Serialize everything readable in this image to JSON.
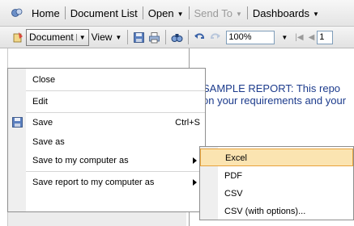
{
  "topnav": {
    "home": "Home",
    "document_list": "Document List",
    "open": "Open",
    "send_to": "Send To",
    "dashboards": "Dashboards"
  },
  "toolbar": {
    "document": "Document",
    "view": "View",
    "zoom_value": "100%",
    "page_value": "1"
  },
  "menu": {
    "items": [
      {
        "label": "Close"
      },
      {
        "label": "Edit"
      },
      {
        "label": "Save",
        "shortcut": "Ctrl+S"
      },
      {
        "label": "Save as"
      },
      {
        "label": "Save to my computer as"
      },
      {
        "label": "Save report to my computer as"
      }
    ]
  },
  "submenu": {
    "items": [
      {
        "label": "Excel",
        "highlighted": true
      },
      {
        "label": "PDF"
      },
      {
        "label": "CSV"
      },
      {
        "label": "CSV (with options)..."
      }
    ]
  },
  "report": {
    "line1": "SAMPLE REPORT:  This repo",
    "line2": "on your requirements and your"
  },
  "colors": {
    "highlight_bg": "#fbe4b1",
    "highlight_border": "#e8a33c",
    "report_text": "#1c3b8c"
  }
}
